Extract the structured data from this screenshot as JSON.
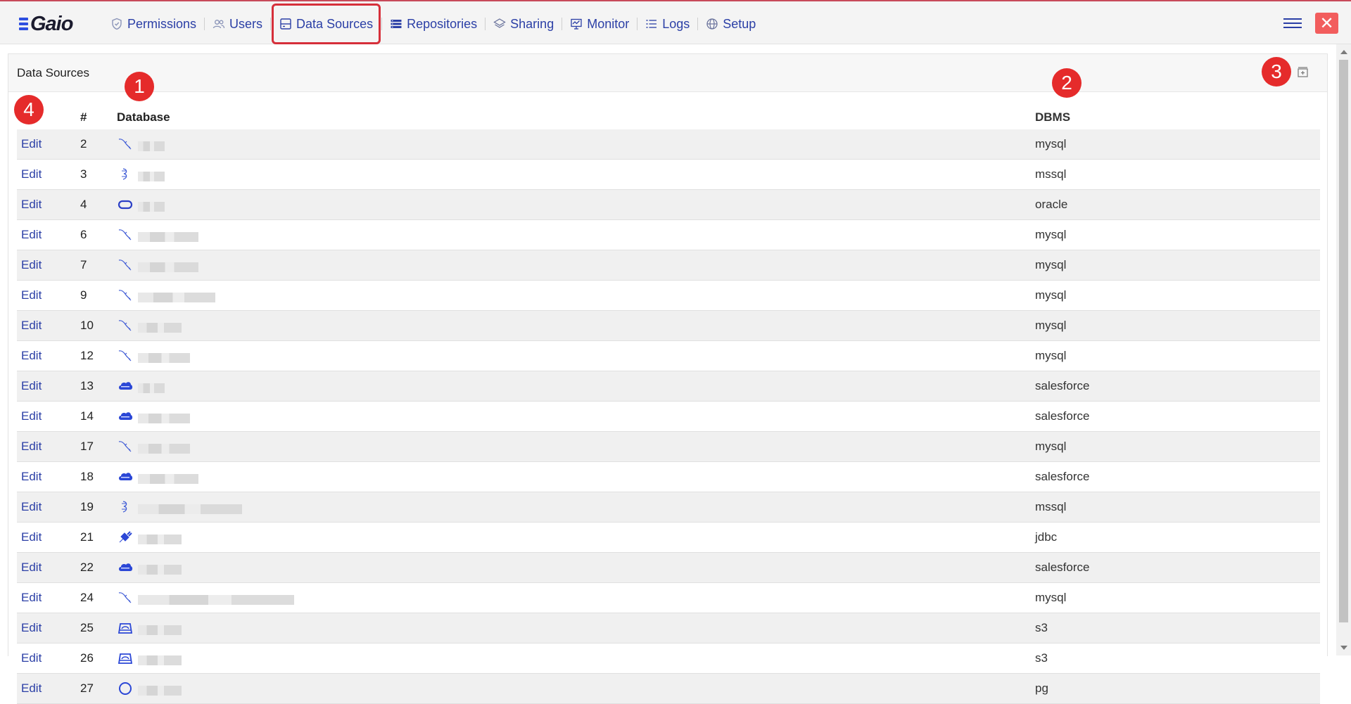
{
  "nav": {
    "logo_text": "Gaio",
    "items": [
      {
        "label": "Permissions",
        "icon": "shield-icon"
      },
      {
        "label": "Users",
        "icon": "users-icon"
      },
      {
        "label": "Data Sources",
        "icon": "database-icon"
      },
      {
        "label": "Repositories",
        "icon": "list-icon"
      },
      {
        "label": "Sharing",
        "icon": "layers-icon"
      },
      {
        "label": "Monitor",
        "icon": "monitor-icon"
      },
      {
        "label": "Logs",
        "icon": "logs-icon"
      },
      {
        "label": "Setup",
        "icon": "globe-icon"
      }
    ],
    "close_symbol": "✕"
  },
  "panel": {
    "title": "Data Sources"
  },
  "badges": [
    "1",
    "2",
    "3",
    "4"
  ],
  "table": {
    "headers": {
      "edit": "",
      "num": "#",
      "database": "Database",
      "dbms": "DBMS"
    },
    "edit_label": "Edit",
    "rows": [
      {
        "num": "2",
        "icon": "mysql-dolphin-icon",
        "dbms": "mysql"
      },
      {
        "num": "3",
        "icon": "mssql-icon",
        "dbms": "mssql"
      },
      {
        "num": "4",
        "icon": "oracle-icon",
        "dbms": "oracle"
      },
      {
        "num": "6",
        "icon": "mysql-dolphin-icon",
        "dbms": "mysql"
      },
      {
        "num": "7",
        "icon": "mysql-dolphin-icon",
        "dbms": "mysql"
      },
      {
        "num": "9",
        "icon": "mysql-dolphin-icon",
        "dbms": "mysql"
      },
      {
        "num": "10",
        "icon": "mysql-dolphin-icon",
        "dbms": "mysql"
      },
      {
        "num": "12",
        "icon": "mysql-dolphin-icon",
        "dbms": "mysql"
      },
      {
        "num": "13",
        "icon": "salesforce-icon",
        "dbms": "salesforce"
      },
      {
        "num": "14",
        "icon": "salesforce-icon",
        "dbms": "salesforce"
      },
      {
        "num": "17",
        "icon": "mysql-dolphin-icon",
        "dbms": "mysql"
      },
      {
        "num": "18",
        "icon": "salesforce-icon",
        "dbms": "salesforce"
      },
      {
        "num": "19",
        "icon": "mssql-icon",
        "dbms": "mssql"
      },
      {
        "num": "21",
        "icon": "plug-icon",
        "dbms": "jdbc"
      },
      {
        "num": "22",
        "icon": "salesforce-icon",
        "dbms": "salesforce"
      },
      {
        "num": "24",
        "icon": "mysql-dolphin-icon",
        "dbms": "mysql"
      },
      {
        "num": "25",
        "icon": "s3-bucket-icon",
        "dbms": "s3"
      },
      {
        "num": "26",
        "icon": "s3-bucket-icon",
        "dbms": "s3"
      },
      {
        "num": "27",
        "icon": "postgres-icon",
        "dbms": "pg"
      }
    ]
  },
  "colors": {
    "accent": "#2b3fa6",
    "highlight": "#d62f3a",
    "badge": "#e52b2b",
    "close": "#f25d5d"
  }
}
